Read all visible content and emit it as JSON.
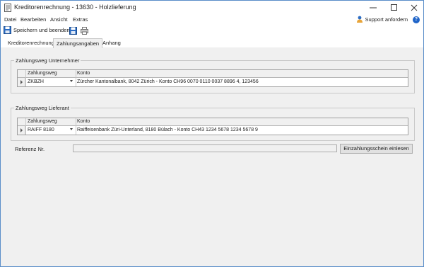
{
  "window": {
    "title": "Kreditorenrechnung - 13630 - Holzlieferung"
  },
  "menu": {
    "items": [
      "Datei",
      "Bearbeiten",
      "Ansicht",
      "Extras"
    ],
    "support_label": "Support anfordern",
    "help_label": "?"
  },
  "toolbar": {
    "save_close_label": "Speichern und beenden"
  },
  "tabs": {
    "items": [
      "Kreditorenrechnung",
      "Zahlungsangaben",
      "Anhang"
    ],
    "active": "Zahlungsangaben"
  },
  "unternehmer": {
    "group_title": "Zahlungsweg Unternehmer",
    "col_zahlungsweg": "Zahlungsweg",
    "col_konto": "Konto",
    "row_zahlungsweg": "ZKBZH",
    "row_konto": "Zürcher Kantonalbank, 8042 Zürich - Konto CH96 0070 0110 0037 8896 4, 123456"
  },
  "lieferant": {
    "group_title": "Zahlungsweg Lieferant",
    "col_zahlungsweg": "Zahlungsweg",
    "col_konto": "Konto",
    "row_zahlungsweg": "RAIFF 8180",
    "row_konto": "Raiffeisenbank Züri-Unterland, 8180 Bülach - Konto CH43 1234 5678 1234 5678 9"
  },
  "referenz": {
    "label": "Referenz Nr.",
    "value": "",
    "button_label": "Einzahlungsschein einlesen"
  }
}
